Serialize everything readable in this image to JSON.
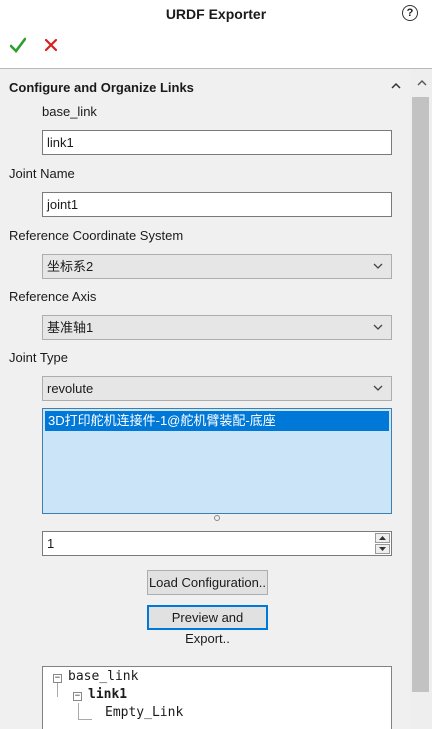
{
  "header": {
    "title": "URDF Exporter",
    "help_glyph": "?"
  },
  "toolbar": {
    "ok_icon": "checkmark-icon",
    "cancel_icon": "close-icon",
    "ok_color": "#2e9e2e",
    "cancel_color": "#d62020"
  },
  "section": {
    "title": "Configure and Organize Links",
    "parent_link_label": "base_link",
    "link_name_value": "link1",
    "joint_name_label": "Joint Name",
    "joint_name_value": "joint1",
    "ref_coord_label": "Reference Coordinate System",
    "ref_coord_value": "坐标系2",
    "ref_axis_label": "Reference Axis",
    "ref_axis_value": "基准轴1",
    "joint_type_label": "Joint Type",
    "joint_type_value": "revolute",
    "components": [
      "3D打印舵机连接件-1@舵机臂装配-底座"
    ],
    "child_count": "1",
    "load_button": "Load Configuration..",
    "preview_button": "Preview and Export.."
  },
  "tree": {
    "items": [
      {
        "label": "base_link",
        "toggle": "−"
      },
      {
        "label": "link1",
        "toggle": "−"
      },
      {
        "label": "Empty_Link"
      }
    ]
  }
}
